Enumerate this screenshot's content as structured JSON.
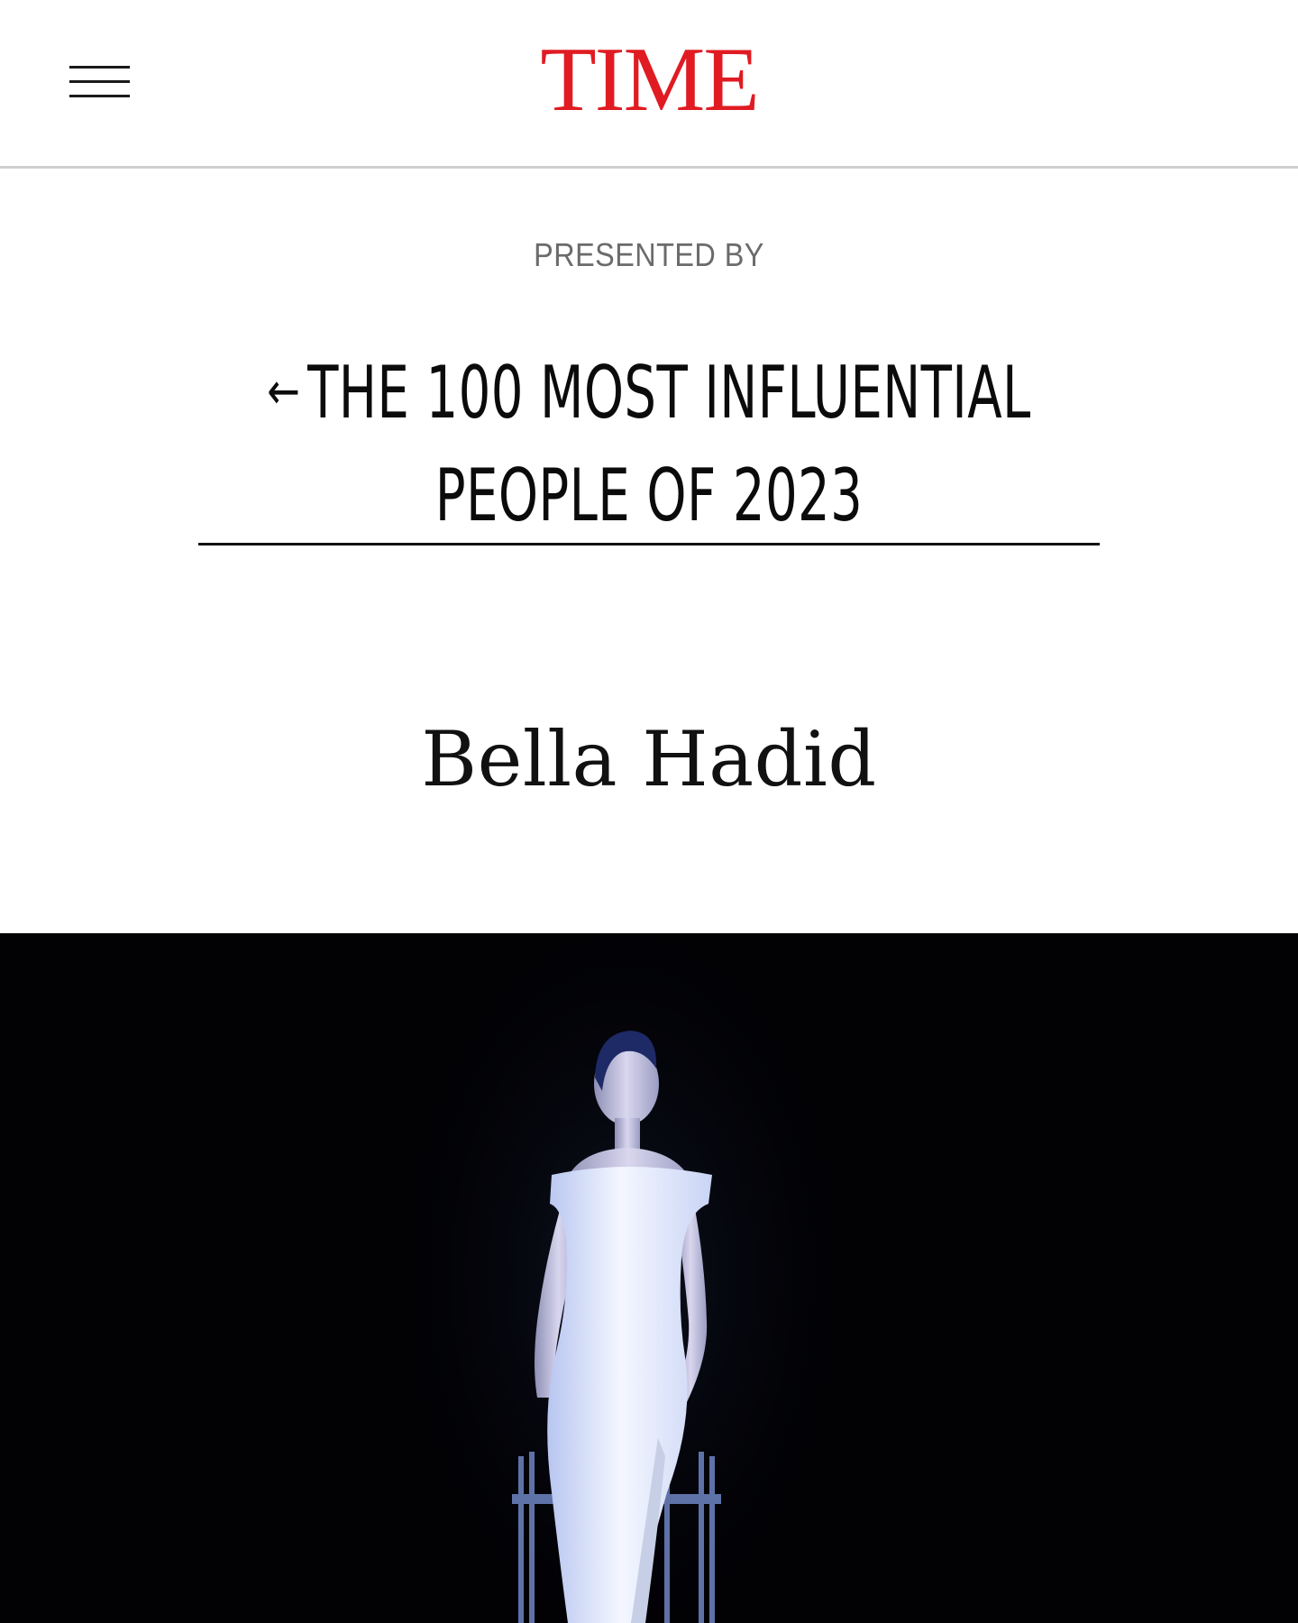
{
  "header": {
    "logo_text": "TIME",
    "logo_color": "#e01b22",
    "menu_icon": "hamburger-menu-icon"
  },
  "sponsor": {
    "label": "PRESENTED BY"
  },
  "section": {
    "arrow": "←",
    "title_line1": "THE 100 MOST INFLUENTIAL",
    "title_line2": "PEOPLE OF 2023"
  },
  "profile": {
    "name": "Bella Hadid"
  },
  "hero": {
    "background_color": "#020205",
    "dress_color": "#f2f5ff"
  }
}
